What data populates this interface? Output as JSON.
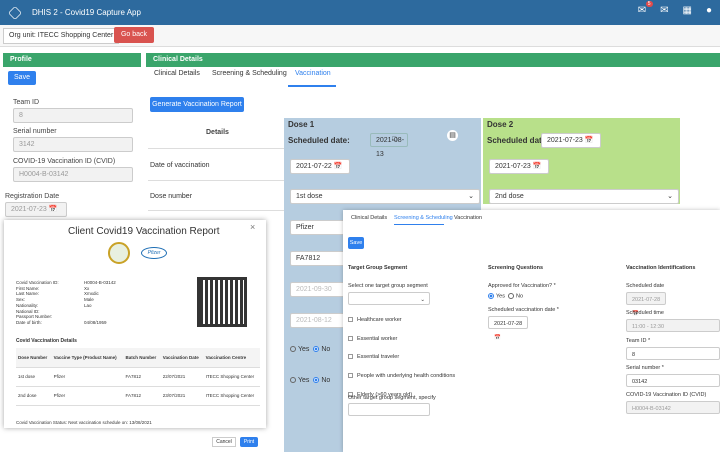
{
  "app": {
    "title": "DHIS 2 - Covid19 Capture App",
    "notif_count": "5"
  },
  "org": {
    "label": "Org unit: ITECC Shopping Center",
    "go_back": "Go back"
  },
  "profile": {
    "header": "Profile",
    "save": "Save",
    "team_id_label": "Team ID",
    "team_id": "8",
    "serial_label": "Serial number",
    "serial": "3142",
    "cvid_label": "COVID-19 Vaccination ID (CVID)",
    "cvid": "H0004-B-03142",
    "reg_date_label": "Registration Date",
    "reg_date": "2021-07-23"
  },
  "clinical": {
    "header": "Clinical Details",
    "tabs": [
      "Clinical Details",
      "Screening & Scheduling",
      "Vaccination"
    ],
    "gen_report": "Generate Vaccination Report",
    "details_label": "Details",
    "rows": [
      "Date of vaccination",
      "Dose number"
    ],
    "dose1": {
      "title": "Dose 1",
      "sched_label": "Scheduled date:",
      "sched": "2021-08-13",
      "date": "2021-07-22",
      "dose": "1st dose",
      "vaccine": "Pfizer",
      "batch": "FA7812",
      "d3": "2021-09-30",
      "d4": "2021-08-12",
      "yes": "Yes",
      "no": "No"
    },
    "dose2": {
      "title": "Dose 2",
      "sched_label": "Scheduled date:",
      "sched": "2021-07-23",
      "date": "2021-07-23",
      "dose": "2nd dose"
    }
  },
  "report": {
    "title": "Client Covid19 Vaccination Report",
    "close": "×",
    "pfizer": "Pfizer",
    "fields": [
      [
        "Covid Vaccination ID:",
        "H0004-B-03142"
      ],
      [
        "First Name:",
        "Xx"
      ],
      [
        "Last Name:",
        "Xmxdic"
      ],
      [
        "Sex:",
        "Male"
      ],
      [
        "Nationality:",
        "Lao"
      ],
      [
        "National ID:",
        ""
      ],
      [
        "Passport Number:",
        ""
      ],
      [
        "Date of birth:",
        "04/08/1959"
      ]
    ],
    "details_title": "Covid Vaccination Details",
    "cols": [
      "Dose Number",
      "Vaccine Type (Product Name)",
      "Batch Number",
      "Vaccination Date",
      "Vaccination Centre"
    ],
    "rows": [
      [
        "1st dose",
        "Pfizer",
        "FA7812",
        "22/07/2021",
        "ITECC Shopping Center"
      ],
      [
        "2nd dose",
        "Pfizer",
        "FA7812",
        "23/07/2021",
        "ITECC Shopping Center"
      ]
    ],
    "status": "Covid Vaccination Status: Next vaccination schedule on: 13/08/2021",
    "cancel": "Cancel",
    "print": "Print"
  },
  "screening": {
    "tabs": [
      "Clinical Details",
      "Screening & Scheduling",
      "Vaccination"
    ],
    "save": "Save",
    "tgs_title": "Target Group Segment",
    "tgs_select": "Select one target group segment",
    "groups": [
      "Healthcare worker",
      "Essential worker",
      "Essential traveler",
      "People with underlying health conditions",
      "Elderly (>60 years old)"
    ],
    "other_label": "Other target group segment, specify",
    "sq_title": "Screening Questions",
    "approved_label": "Approved for Vaccination? *",
    "yes": "Yes",
    "no": "No",
    "sched_label": "Scheduled vaccination date *",
    "sched": "2021-07-28",
    "vi_title": "Vaccination Identifications",
    "sd_label": "Scheduled date",
    "sd": "2021-07-28",
    "st_label": "Scheduled time",
    "st": "11:00 - 12:30",
    "team_label": "Team ID *",
    "team": "8",
    "serial_label": "Serial number *",
    "serial": "03142",
    "cvid_label": "COVID-19 Vaccination ID (CVID)",
    "cvid": "H0004-B-03142"
  }
}
